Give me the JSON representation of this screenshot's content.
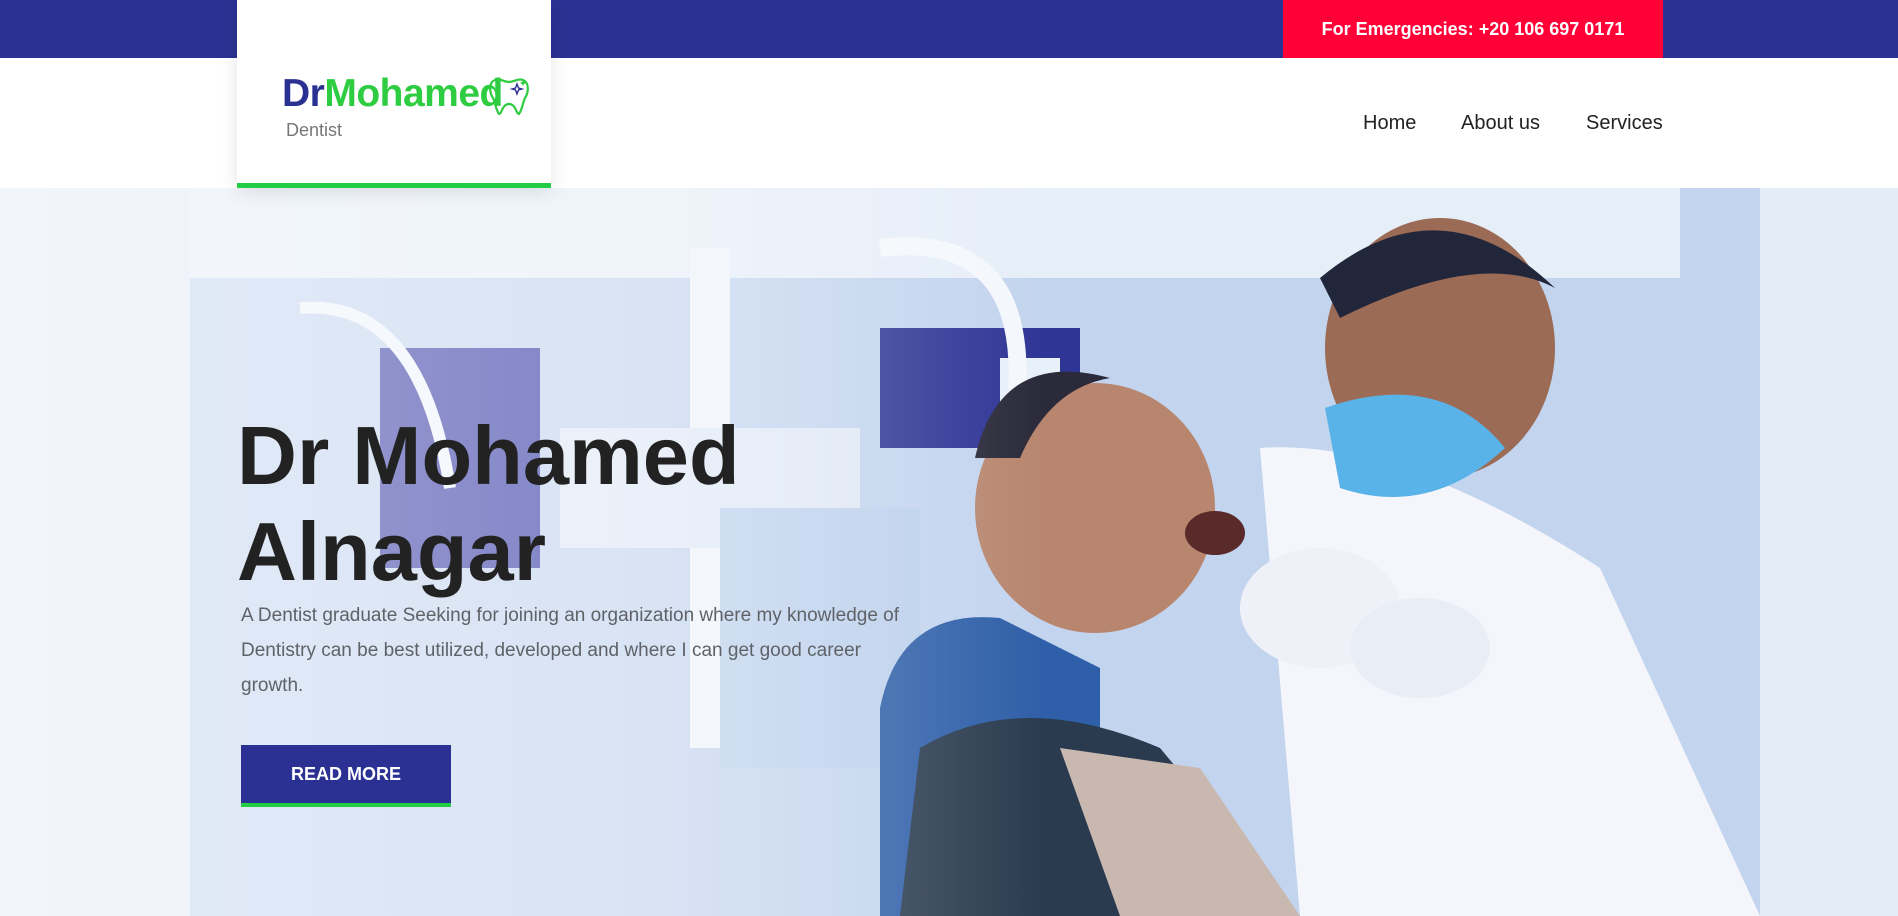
{
  "topbar": {
    "emergency_label": "For Emergencies: +20 106 697 0171"
  },
  "logo": {
    "dr": "Dr",
    "name": "Mohamed",
    "subtitle": "Dentist",
    "icon": "tooth-icon"
  },
  "nav": {
    "items": [
      {
        "label": "Home"
      },
      {
        "label": "About us"
      },
      {
        "label": "Services"
      }
    ]
  },
  "hero": {
    "title_line1": "Dr Mohamed",
    "title_line2": "Alnagar",
    "description": "A Dentist graduate Seeking for joining an organization where my knowledge of Dentistry can be best utilized, developed and where I can get good career growth.",
    "button_label": "READ MORE"
  },
  "colors": {
    "brand_blue": "#2b3192",
    "brand_green": "#22cc44",
    "emergency_red": "#ff0037"
  }
}
